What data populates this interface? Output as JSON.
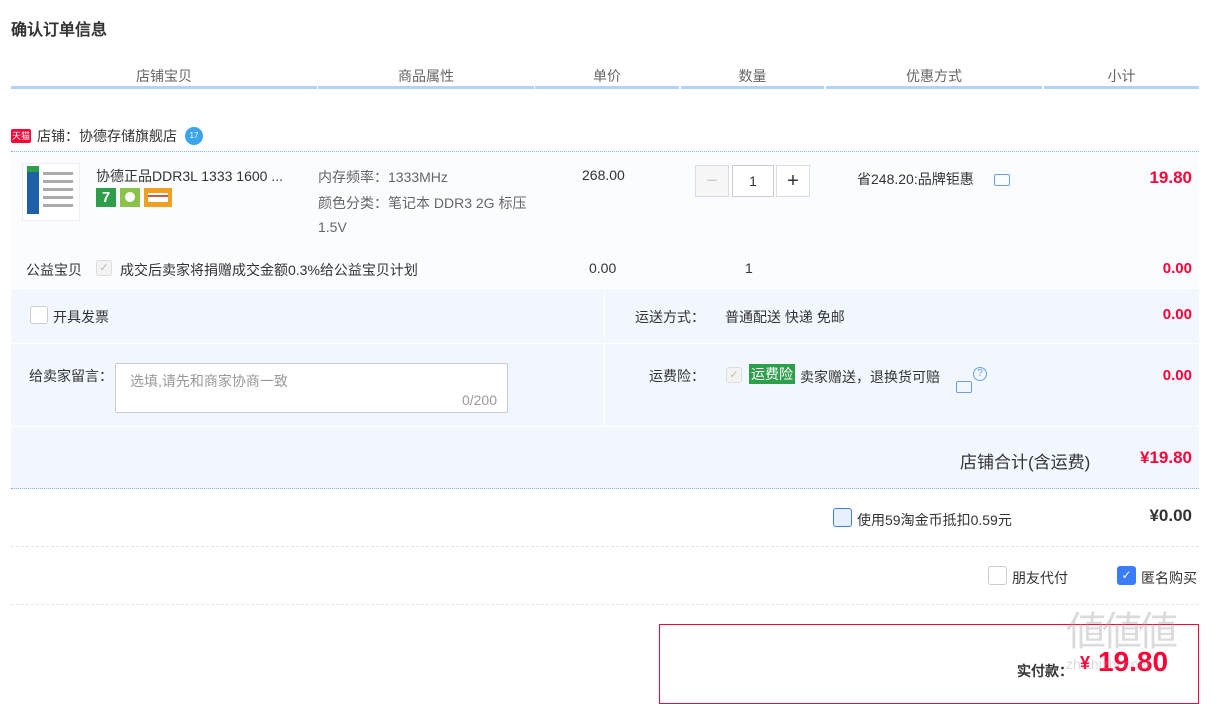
{
  "page": {
    "title": "确认订单信息"
  },
  "table_header": {
    "columns": [
      "店铺宝贝",
      "商品属性",
      "单价",
      "数量",
      "优惠方式",
      "小计"
    ]
  },
  "shop": {
    "badge": "天猫",
    "label": "店铺：协德存储旗舰店",
    "wangwang_badge": "17"
  },
  "item": {
    "name": "协德正品DDR3L 1333 1600 ...",
    "attr_freq": "内存频率：1333MHz",
    "attr_color": "颜色分类：笔记本 DDR3 2G 标压 1.5V",
    "unit_price": "268.00",
    "quantity": "1",
    "discount": "省248.20:品牌钜惠",
    "subtotal": "19.80",
    "badge_7": "7"
  },
  "charity": {
    "label": "公益宝贝",
    "text": "成交后卖家将捐赠成交金额0.3%给公益宝贝计划",
    "price": "0.00",
    "quantity": "1",
    "subtotal": "0.00"
  },
  "invoice": {
    "label": "开具发票"
  },
  "shipping": {
    "label": "运送方式：",
    "value": "普通配送 快递 免邮",
    "price": "0.00"
  },
  "message": {
    "label": "给卖家留言：",
    "placeholder": "选填,请先和商家协商一致",
    "counter": "0/200"
  },
  "freight_insurance": {
    "label": "运费险：",
    "badge": "运费险",
    "text": "卖家赠送，退换货可赔",
    "price": "0.00"
  },
  "shop_total": {
    "label": "店铺合计(含运费)",
    "value": "¥19.80"
  },
  "taobao_coin": {
    "label": "使用59淘金币抵扣0.59元",
    "value": "¥0.00"
  },
  "options": {
    "friend_pay": "朋友代付",
    "anonymous": "匿名购买"
  },
  "payment": {
    "label": "实付款：",
    "currency": "¥",
    "value": "19.80"
  },
  "watermark": "值 什么值得买 zhizhizhi.com",
  "colors": {
    "accent_red": "#ff0036",
    "header_line": "#b2d1ff",
    "checkbox_blue": "#3b7cf8"
  }
}
